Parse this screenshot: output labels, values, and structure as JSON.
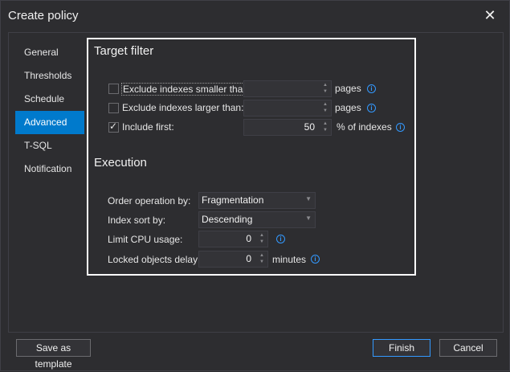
{
  "window": {
    "title": "Create policy",
    "close_icon": "close-icon"
  },
  "nav": {
    "items": [
      {
        "label": "General"
      },
      {
        "label": "Thresholds"
      },
      {
        "label": "Schedule"
      },
      {
        "label": "Advanced"
      },
      {
        "label": "T-SQL"
      },
      {
        "label": "Notification"
      }
    ],
    "selected": "Advanced"
  },
  "target_filter": {
    "title": "Target filter",
    "rows": [
      {
        "label": "Exclude indexes smaller than:",
        "checked": false,
        "value": "",
        "unit": "pages"
      },
      {
        "label": "Exclude indexes larger than:",
        "checked": false,
        "value": "",
        "unit": "pages"
      },
      {
        "label": "Include first:",
        "checked": true,
        "value": "50",
        "unit": "% of indexes"
      }
    ]
  },
  "execution": {
    "title": "Execution",
    "order_label": "Order operation by:",
    "order_value": "Fragmentation",
    "sort_label": "Index sort by:",
    "sort_value": "Descending",
    "cpu_label": "Limit CPU usage:",
    "cpu_value": "0",
    "locked_label": "Locked objects delay:",
    "locked_value": "0",
    "locked_unit": "minutes"
  },
  "buttons": {
    "save_template": "Save as template",
    "finish": "Finish",
    "cancel": "Cancel"
  },
  "colors": {
    "accent": "#007acc",
    "info": "#3399ff",
    "background": "#2d2d30"
  }
}
